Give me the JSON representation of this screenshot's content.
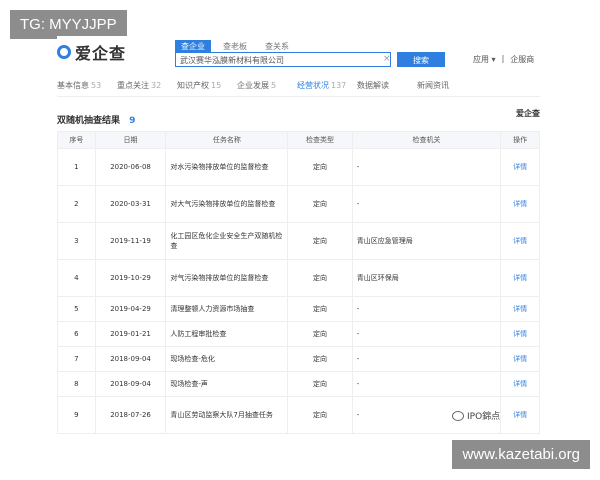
{
  "overlay": {
    "tag": "TG: MYYJJPP",
    "site": "www.kazetabi.org"
  },
  "app": {
    "logo_text": "爱企查"
  },
  "search": {
    "tabs": [
      "查企业",
      "查老板",
      "查关系"
    ],
    "value": "武汉赛华泓膜新材料有限公司",
    "button": "搜索"
  },
  "topright": [
    "应用 ▾",
    "|",
    "企服商"
  ],
  "tabs": [
    {
      "label": "基本信息",
      "count": "53"
    },
    {
      "label": "重点关注",
      "count": "32"
    },
    {
      "label": "知识产权",
      "count": "15"
    },
    {
      "label": "企业发展",
      "count": "5"
    },
    {
      "label": "经营状况",
      "count": "137"
    },
    {
      "label": "数据解读",
      "count": ""
    },
    {
      "label": "新闻资讯",
      "count": ""
    }
  ],
  "section": {
    "title": "双随机抽查结果",
    "count": "9",
    "brand": "爱企查"
  },
  "table": {
    "headers": [
      "序号",
      "日期",
      "任务名称",
      "检查类型",
      "检查机关",
      "操作"
    ],
    "rows": [
      {
        "no": "1",
        "date": "2020-06-08",
        "name": "对水污染物排放单位的监督检查",
        "type": "定向",
        "org": "-",
        "op": "详情"
      },
      {
        "no": "2",
        "date": "2020-03-31",
        "name": "对大气污染物排放单位的监督检查",
        "type": "定向",
        "org": "-",
        "op": "详情"
      },
      {
        "no": "3",
        "date": "2019-11-19",
        "name": "化工园区危化企业安全生产双随机检查",
        "type": "定向",
        "org": "青山区应急管理局",
        "op": "详情"
      },
      {
        "no": "4",
        "date": "2019-10-29",
        "name": "对气污染物排放单位的监督检查",
        "type": "定向",
        "org": "青山区环保局",
        "op": "详情"
      },
      {
        "no": "5",
        "date": "2019-04-29",
        "name": "清理整顿人力资源市场抽查",
        "type": "定向",
        "org": "-",
        "op": "详情"
      },
      {
        "no": "6",
        "date": "2019-01-21",
        "name": "人防工程审批检查",
        "type": "定向",
        "org": "-",
        "op": "详情"
      },
      {
        "no": "7",
        "date": "2018-09-04",
        "name": "现场检查-危化",
        "type": "定向",
        "org": "-",
        "op": "详情"
      },
      {
        "no": "8",
        "date": "2018-09-04",
        "name": "现场检查-声",
        "type": "定向",
        "org": "-",
        "op": "详情"
      },
      {
        "no": "9",
        "date": "2018-07-26",
        "name": "青山区劳动监察大队7月抽查任务",
        "type": "定向",
        "org": "-",
        "op": "详情"
      }
    ]
  },
  "watermark": {
    "text": "IPO錦点"
  }
}
